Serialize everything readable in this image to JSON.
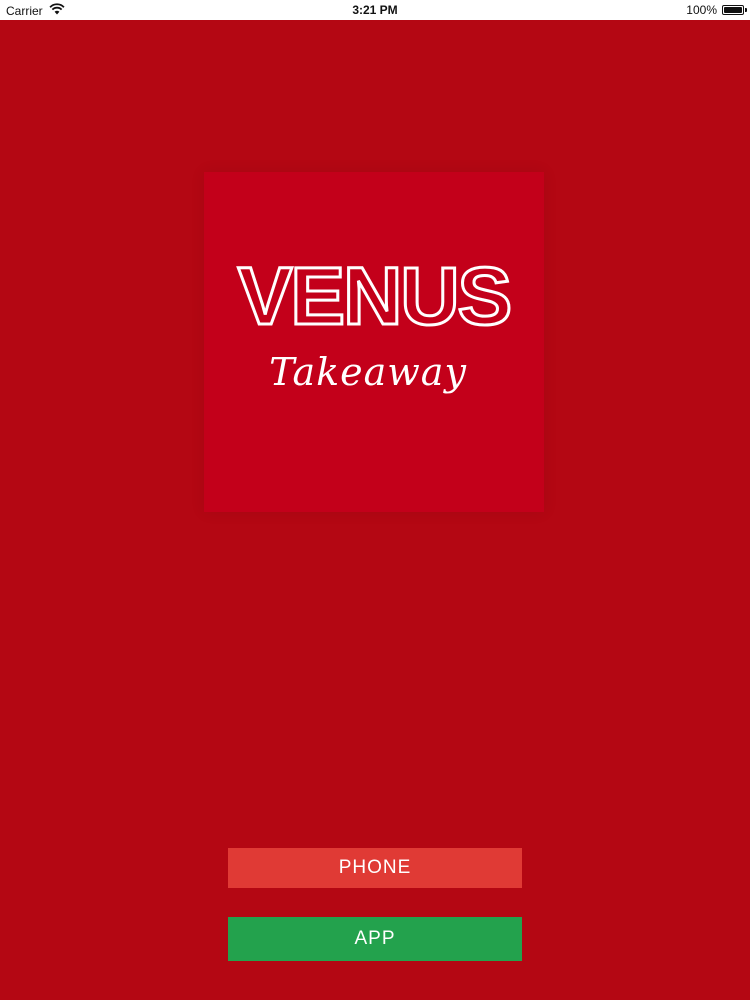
{
  "status_bar": {
    "carrier": "Carrier",
    "time": "3:21 PM",
    "battery": "100%"
  },
  "logo": {
    "title": "VENUS",
    "subtitle": "Takeaway"
  },
  "buttons": {
    "phone_label": "PHONE",
    "app_label": "APP"
  },
  "colors": {
    "background": "#b40713",
    "logo_box": "#c3001a",
    "phone_button": "#e03a35",
    "app_button": "#23a24d"
  },
  "icons": [
    "wifi-icon",
    "battery-icon"
  ]
}
